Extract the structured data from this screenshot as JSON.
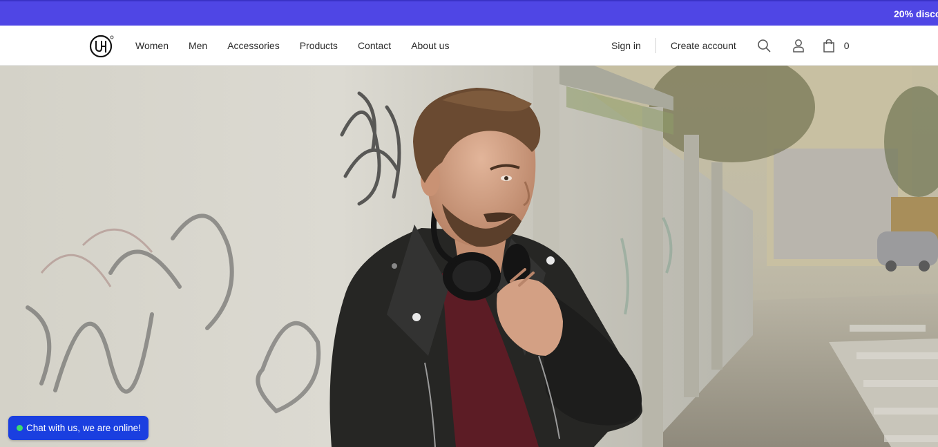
{
  "announcement": {
    "text": "20% disco"
  },
  "header": {
    "nav": [
      {
        "label": "Women"
      },
      {
        "label": "Men"
      },
      {
        "label": "Accessories"
      },
      {
        "label": "Products"
      },
      {
        "label": "Contact"
      },
      {
        "label": "About us"
      }
    ],
    "sign_in": "Sign in",
    "create_account": "Create account",
    "cart_count": "0",
    "icons": {
      "logo": "brand-logo",
      "search": "search-icon",
      "user": "user-icon",
      "cart": "shopping-bag-icon"
    }
  },
  "chat": {
    "label": "Chat with us, we are online!"
  },
  "colors": {
    "announcement_bg": "#4f46e5",
    "chat_bg": "#1a3fe0",
    "online_dot": "#3ddc6b",
    "text": "#2b2b2b"
  }
}
